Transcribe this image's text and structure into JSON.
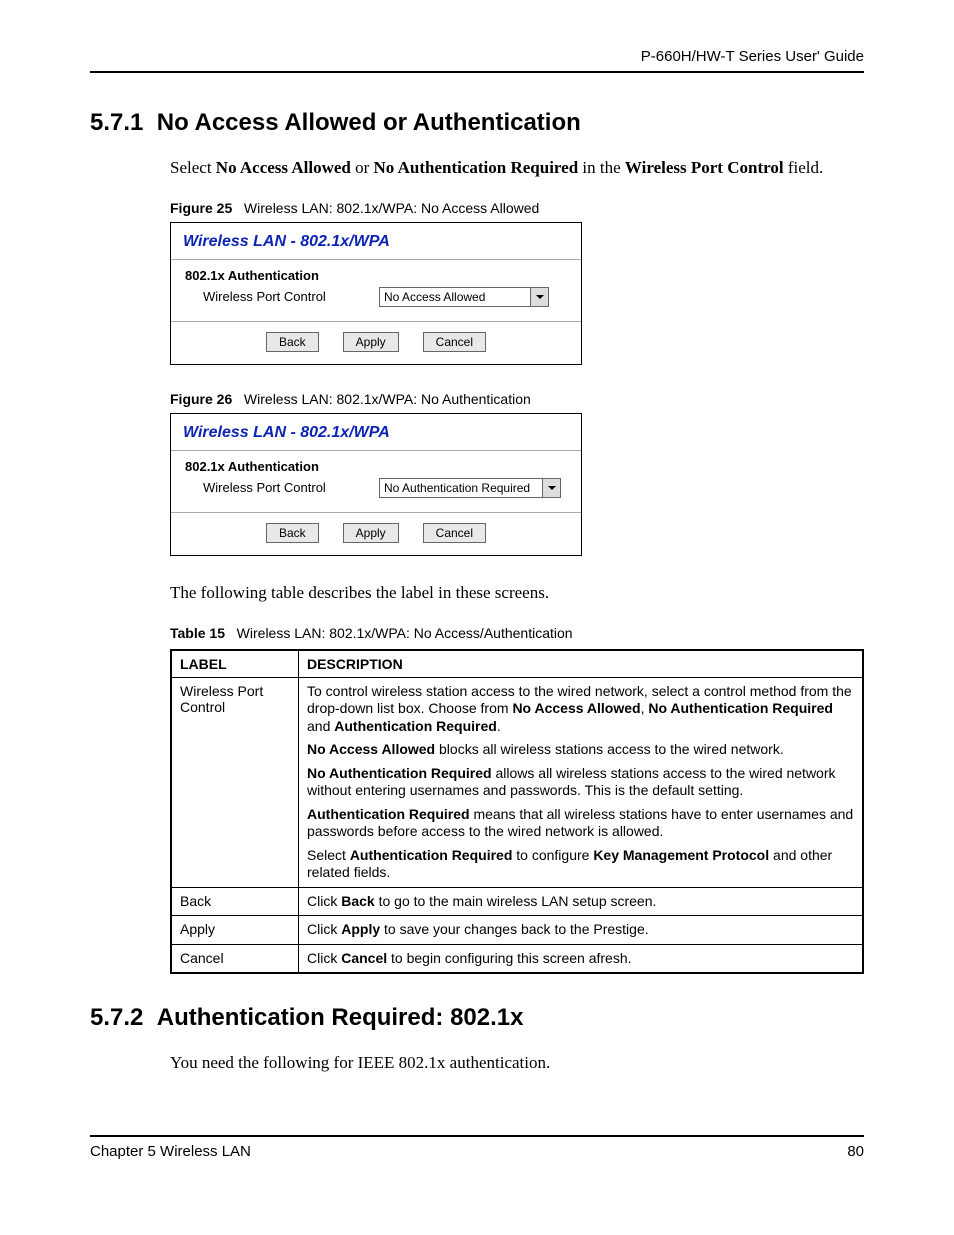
{
  "header_guide": "P-660H/HW-T Series User' Guide",
  "section571_no": "5.7.1",
  "section571_title": "No Access Allowed or Authentication",
  "intro": {
    "t1": "Select ",
    "b1": "No Access Allowed",
    "t2": " or ",
    "b2": "No Authentication Required",
    "t3": " in the ",
    "b3": "Wireless Port Control",
    "t4": " field."
  },
  "fig25": {
    "label": "Figure 25",
    "caption": "Wireless LAN: 802.1x/WPA: No Access Allowed"
  },
  "fig26": {
    "label": "Figure 26",
    "caption": "Wireless LAN: 802.1x/WPA: No Authentication"
  },
  "panel": {
    "title": "Wireless LAN - 802.1x/WPA",
    "group": "802.1x Authentication",
    "rowlabel": "Wireless Port Control",
    "sel1": "No Access Allowed",
    "sel2": "No Authentication Required",
    "btn_back": "Back",
    "btn_apply": "Apply",
    "btn_cancel": "Cancel"
  },
  "body_after_figs": "The following table describes the label in these screens.",
  "tbl15": {
    "label": "Table 15",
    "caption": "Wireless LAN: 802.1x/WPA: No Access/Authentication"
  },
  "tbl": {
    "h_label": "LABEL",
    "h_desc": "DESCRIPTION",
    "rows": {
      "wpc_label": "Wireless Port Control",
      "wpc_p1_a": "To control wireless station access to the wired network, select a control method from the drop-down list box. Choose from ",
      "wpc_p1_b1": "No Access Allowed",
      "wpc_p1_c": ", ",
      "wpc_p1_b2": "No Authentication Required",
      "wpc_p1_d": " and ",
      "wpc_p1_b3": "Authentication Required",
      "wpc_p1_e": ".",
      "wpc_p2_b": "No Access Allowed",
      "wpc_p2_t": " blocks all wireless stations access to the wired network.",
      "wpc_p3_b": "No Authentication Required",
      "wpc_p3_t": " allows all wireless stations access to the wired network without entering usernames and passwords. This is the default setting.",
      "wpc_p4_b": "Authentication Required",
      "wpc_p4_t": " means that all wireless stations have to enter usernames and passwords before access to the wired network is allowed.",
      "wpc_p5_a": "Select ",
      "wpc_p5_b1": "Authentication Required",
      "wpc_p5_c": " to configure ",
      "wpc_p5_b2": "Key Management Protocol",
      "wpc_p5_d": " and other related fields.",
      "back_label": "Back",
      "back_a": "Click ",
      "back_b": "Back",
      "back_c": " to go to the main wireless LAN setup screen.",
      "apply_label": "Apply",
      "apply_a": "Click ",
      "apply_b": "Apply",
      "apply_c": " to save your changes back to the Prestige.",
      "cancel_label": "Cancel",
      "cancel_a": "Click ",
      "cancel_b": "Cancel",
      "cancel_c": " to begin configuring this screen afresh."
    }
  },
  "section572_no": "5.7.2",
  "section572_title": "Authentication Required: 802.1x",
  "body572": "You need the following for IEEE 802.1x authentication.",
  "footer_left": "Chapter 5 Wireless LAN",
  "footer_right": "80"
}
